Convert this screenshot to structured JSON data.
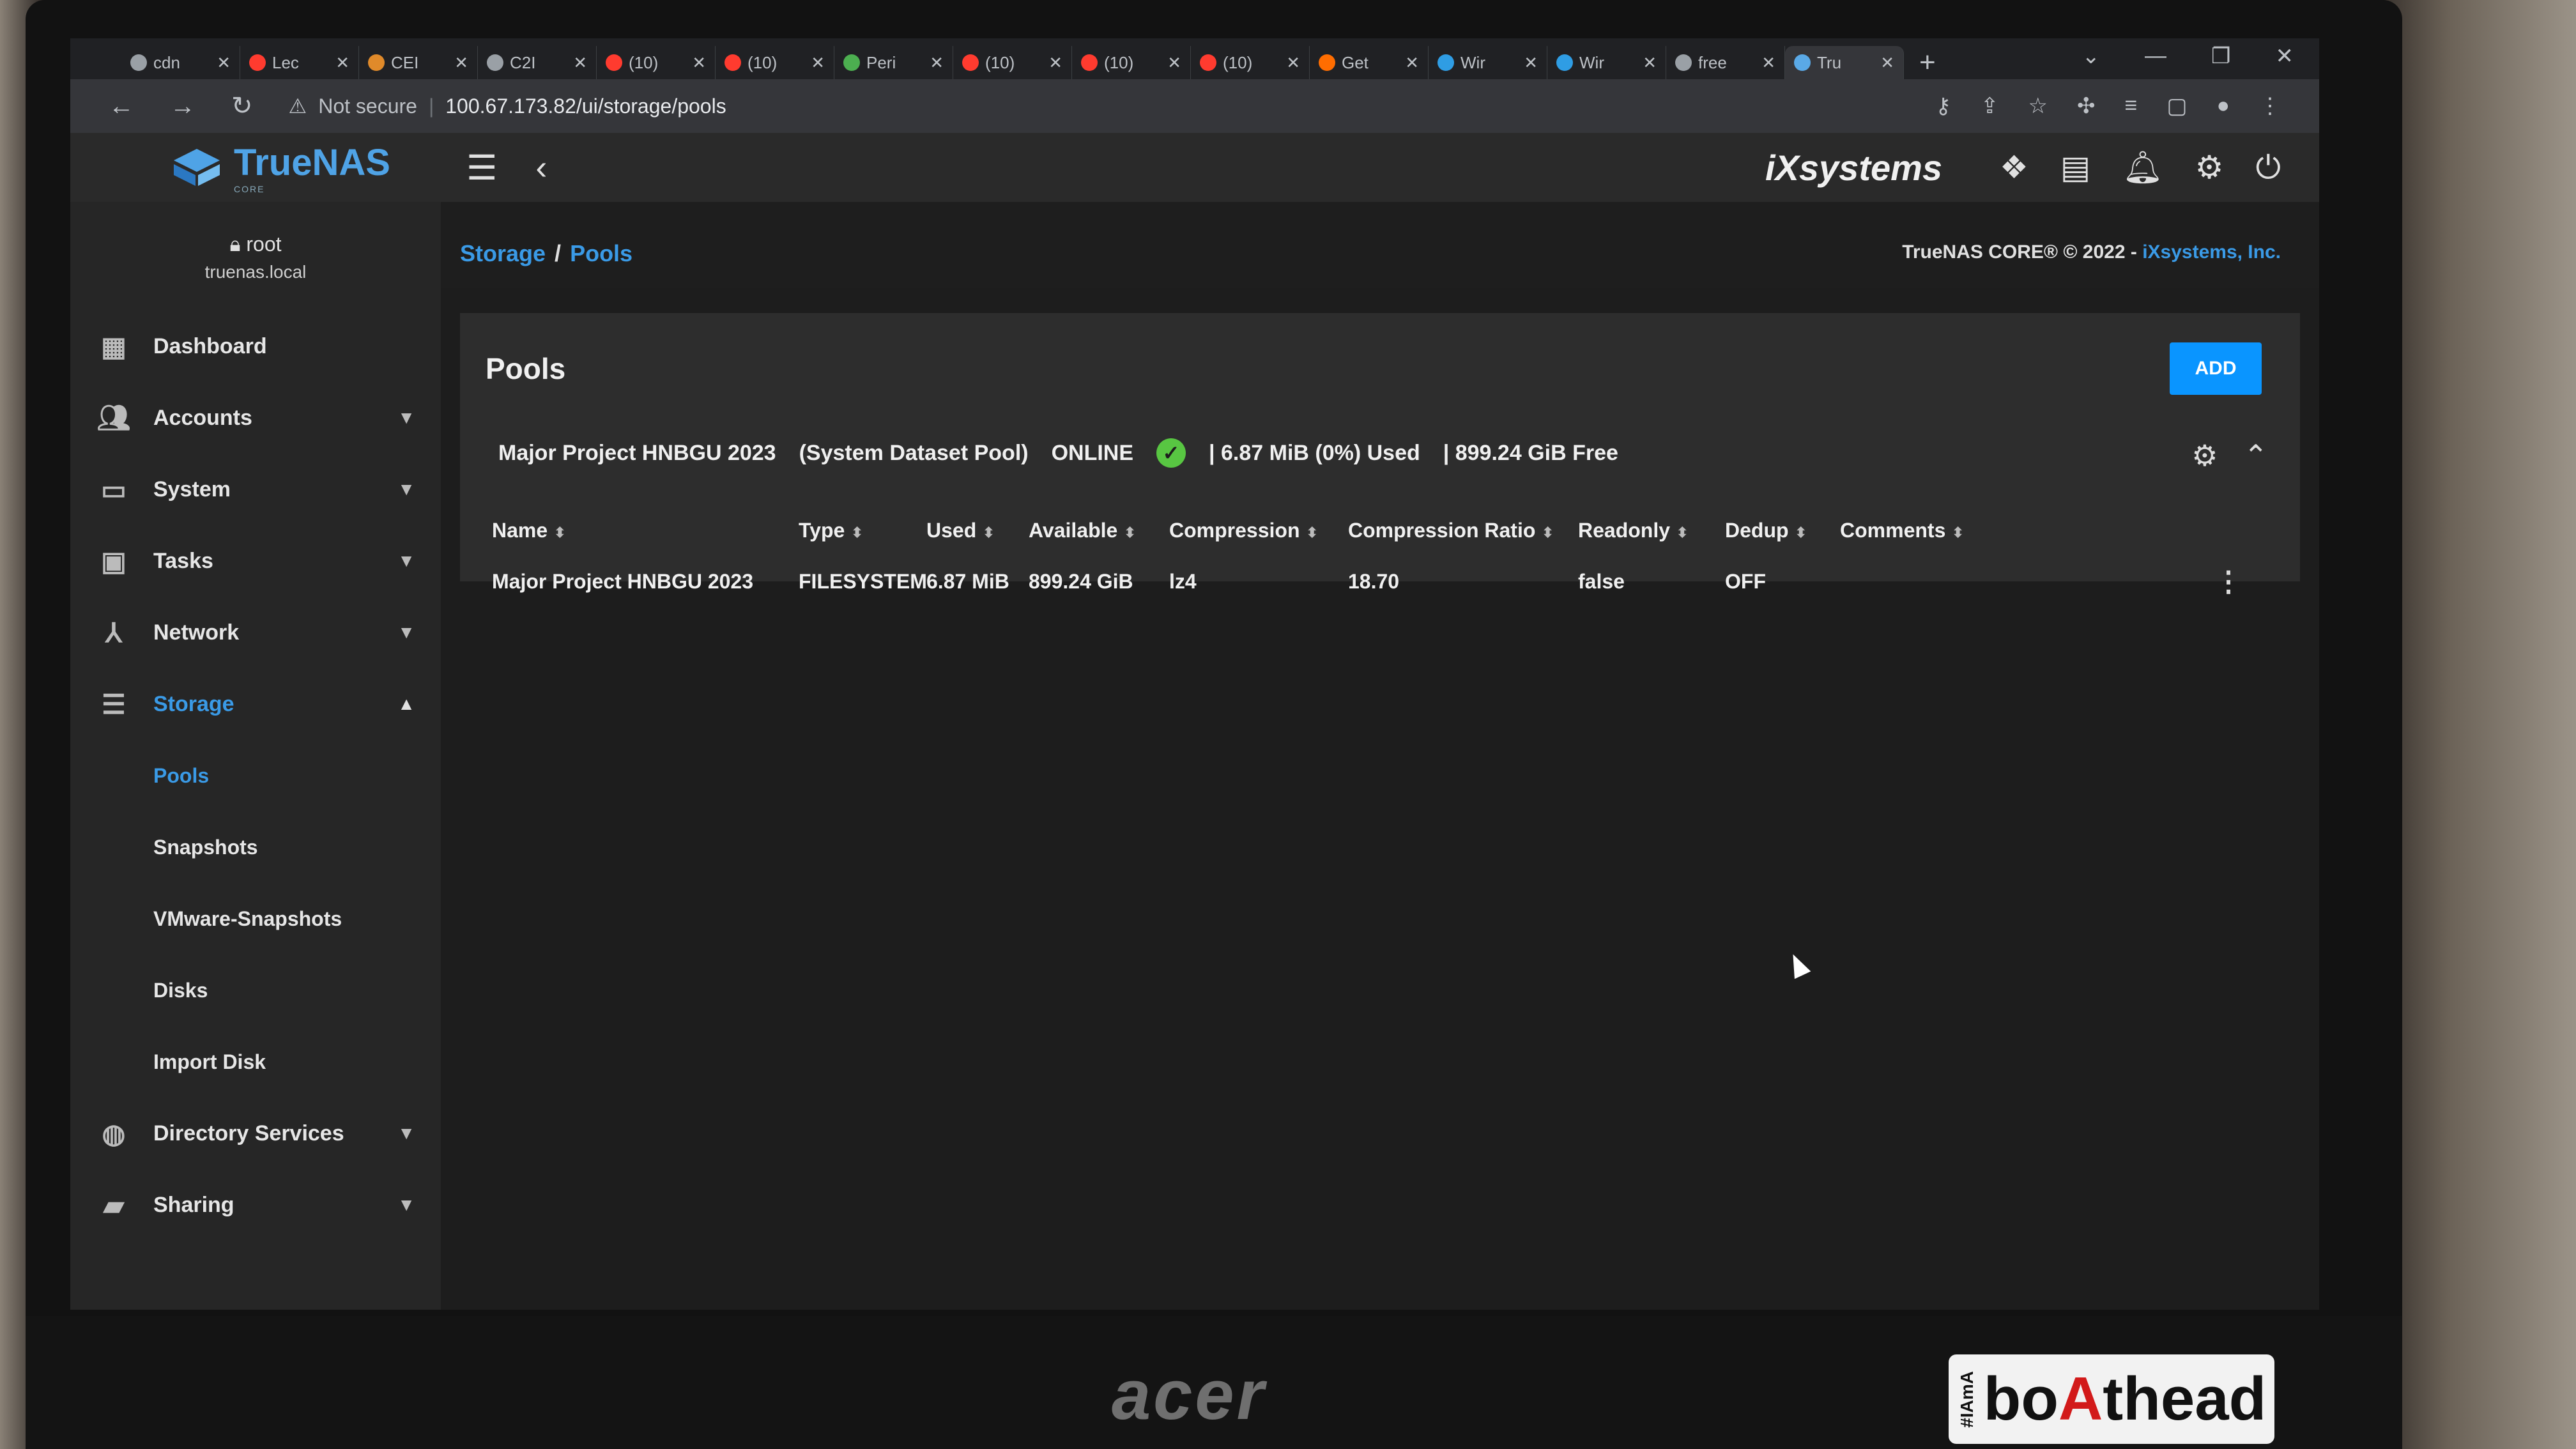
{
  "browser": {
    "tabs": [
      {
        "label": "cdn",
        "color": "#9aa0a6"
      },
      {
        "label": "Lec",
        "color": "#ff3b2f"
      },
      {
        "label": "CEI",
        "color": "#e08a2a"
      },
      {
        "label": "C2I",
        "color": "#9aa0a6"
      },
      {
        "label": "(10)",
        "color": "#ff3b2f"
      },
      {
        "label": "(10)",
        "color": "#ff3b2f"
      },
      {
        "label": "Peri",
        "color": "#4caf50"
      },
      {
        "label": "(10)",
        "color": "#ff3b2f"
      },
      {
        "label": "(10)",
        "color": "#ff3b2f"
      },
      {
        "label": "(10)",
        "color": "#ff3b2f"
      },
      {
        "label": "Get",
        "color": "#ff6d00"
      },
      {
        "label": "Wir",
        "color": "#2f9de4"
      },
      {
        "label": "Wir",
        "color": "#2f9de4"
      },
      {
        "label": "free",
        "color": "#9aa0a6"
      },
      {
        "label": "Tru",
        "color": "#5aa9e6"
      }
    ],
    "security_label": "Not secure",
    "url": "100.67.173.82/ui/storage/pools"
  },
  "app": {
    "brand": "TrueNAS",
    "brand_sub": "CORE",
    "vendor": "iXsystems"
  },
  "user": {
    "name": "root",
    "host": "truenas.local"
  },
  "nav": {
    "dashboard": "Dashboard",
    "accounts": "Accounts",
    "system": "System",
    "tasks": "Tasks",
    "network": "Network",
    "storage": "Storage",
    "storage_sub": {
      "pools": "Pools",
      "snapshots": "Snapshots",
      "vmware_snapshots": "VMware-Snapshots",
      "disks": "Disks",
      "import_disk": "Import Disk"
    },
    "directory_services": "Directory Services",
    "sharing": "Sharing"
  },
  "breadcrumb": {
    "storage": "Storage",
    "separator": "/",
    "pools": "Pools"
  },
  "copyright": {
    "text": "TrueNAS CORE® © 2022 -",
    "link": "iXsystems, Inc."
  },
  "pools_card": {
    "title": "Pools",
    "add_label": "ADD",
    "pool_name": "Major Project HNBGU 2023",
    "pool_role": "(System Dataset Pool)",
    "status": "ONLINE",
    "used_summary": "| 6.87 MiB (0%) Used",
    "free_summary": "| 899.24 GiB Free"
  },
  "table": {
    "columns": [
      "Name",
      "Type",
      "Used",
      "Available",
      "Compression",
      "Compression Ratio",
      "Readonly",
      "Dedup",
      "Comments"
    ],
    "rows": [
      [
        "Major Project HNBGU 2023",
        "FILESYSTEM",
        "6.87 MiB",
        "899.24 GiB",
        "lz4",
        "18.70",
        "false",
        "OFF",
        ""
      ]
    ]
  },
  "hardware": {
    "laptop_brand": "acer",
    "sticker": "boAthead",
    "sticker_tag": "#IAmA"
  }
}
